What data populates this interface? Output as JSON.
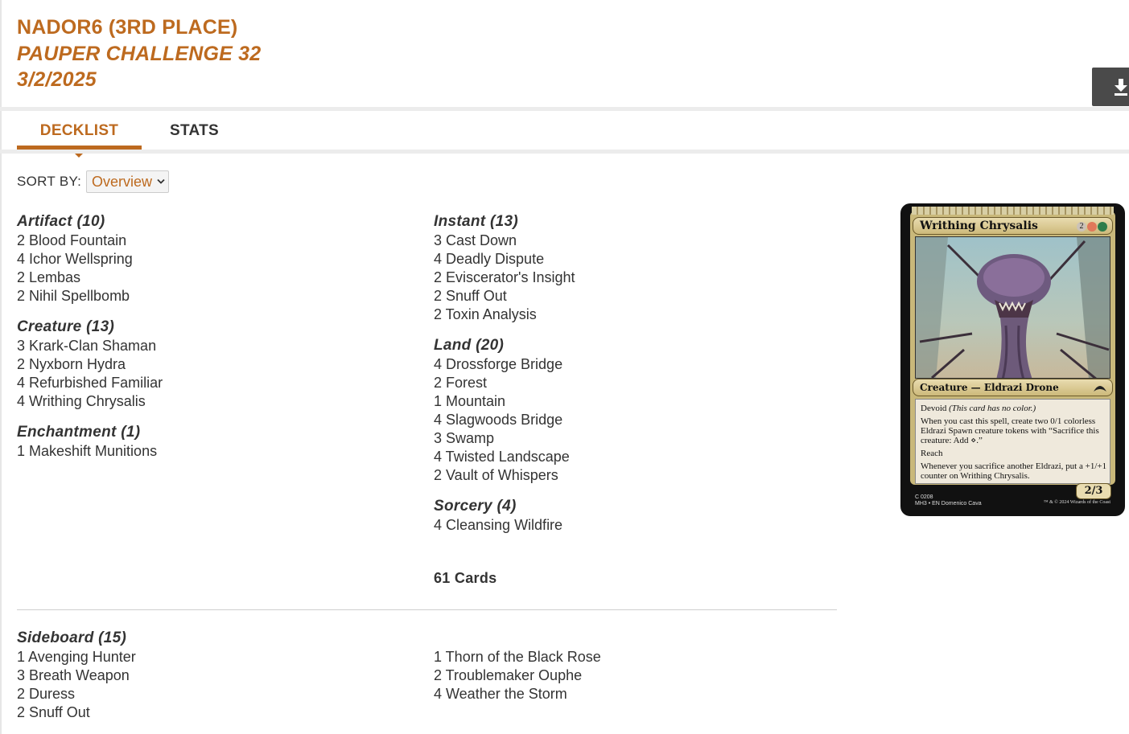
{
  "header": {
    "player": "NADOR6 (3RD PLACE)",
    "event": "PAUPER CHALLENGE 32",
    "date": "3/2/2025"
  },
  "download_icon": "download-icon",
  "tabs": [
    {
      "label": "DECKLIST",
      "active": true
    },
    {
      "label": "STATS",
      "active": false
    }
  ],
  "sort": {
    "label": "SORT BY:",
    "selected": "Overview"
  },
  "deck": {
    "left": [
      {
        "title": "Artifact (10)",
        "cards": [
          "2 Blood Fountain",
          "4 Ichor Wellspring",
          "2 Lembas",
          "2 Nihil Spellbomb"
        ]
      },
      {
        "title": "Creature (13)",
        "cards": [
          "3 Krark-Clan Shaman",
          "2 Nyxborn Hydra",
          "4 Refurbished Familiar",
          "4 Writhing Chrysalis"
        ]
      },
      {
        "title": "Enchantment (1)",
        "cards": [
          "1 Makeshift Munitions"
        ]
      }
    ],
    "right": [
      {
        "title": "Instant (13)",
        "cards": [
          "3 Cast Down",
          "4 Deadly Dispute",
          "2 Eviscerator's Insight",
          "2 Snuff Out",
          "2 Toxin Analysis"
        ]
      },
      {
        "title": "Land (20)",
        "cards": [
          "4 Drossforge Bridge",
          "2 Forest",
          "1 Mountain",
          "4 Slagwoods Bridge",
          "3 Swamp",
          "4 Twisted Landscape",
          "2 Vault of Whispers"
        ]
      },
      {
        "title": "Sorcery (4)",
        "cards": [
          "4 Cleansing Wildfire"
        ]
      }
    ],
    "total": "61 Cards"
  },
  "sideboard": {
    "title": "Sideboard (15)",
    "left": [
      "1 Avenging Hunter",
      "3 Breath Weapon",
      "2 Duress",
      "2 Snuff Out"
    ],
    "right": [
      "1 Thorn of the Black Rose",
      "2 Troublemaker Ouphe",
      "4 Weather the Storm"
    ]
  },
  "card_preview": {
    "name": "Writhing Chrysalis",
    "cost": "2",
    "type_line": "Creature — Eldrazi Drone",
    "text": [
      "Devoid",
      "(This card has no color.)",
      "When you cast this spell, create two 0/1 colorless Eldrazi Spawn creature tokens with “Sacrifice this creature: Add ⋄.”",
      "Reach",
      "Whenever you sacrifice another Eldrazi, put a +1/+1 counter on Writhing Chrysalis."
    ],
    "pt": "2/3",
    "footer_left_1": "C 0208",
    "footer_left_2": "MH3 • EN  Domenico Cava",
    "footer_right": "™ & © 2024 Wizards of the Coast"
  },
  "colors": {
    "accent": "#bd6a1f",
    "text": "#333333",
    "button_dark": "#4a4a4a"
  }
}
